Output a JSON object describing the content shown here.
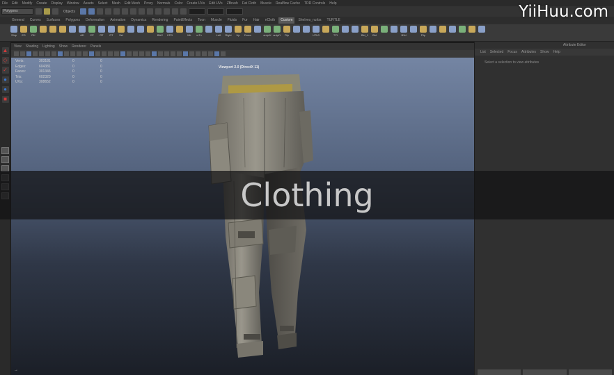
{
  "menubar": {
    "items": [
      "File",
      "Edit",
      "Modify",
      "Create",
      "Display",
      "Window",
      "Assets",
      "Select",
      "Mesh",
      "Edit Mesh",
      "Proxy",
      "Normals",
      "Color",
      "Create UVs",
      "Edit UVs",
      "ZBrush",
      "Fat Cloth",
      "Muscle",
      "Realflow Cache",
      "TDR Controls",
      "Help"
    ]
  },
  "statusline": {
    "mode": "Polygons",
    "snap_label": "Objects"
  },
  "shelf_tabs": {
    "items": [
      "General",
      "Curves",
      "Surfaces",
      "Polygons",
      "Deformation",
      "Animation",
      "Dynamics",
      "Rendering",
      "PaintEffects",
      "Toon",
      "Muscle",
      "Fluids",
      "Fur",
      "Hair",
      "nCloth",
      "Custom",
      "Shelves_nurbs",
      "TURTLE"
    ],
    "active_index": 15
  },
  "shelf": {
    "items": [
      {
        "label": "Ship",
        "color": "c1"
      },
      {
        "label": "ES",
        "color": "c2"
      },
      {
        "label": "RK",
        "color": "c3"
      },
      {
        "label": "",
        "color": "c2"
      },
      {
        "label": "",
        "color": "c2"
      },
      {
        "label": "",
        "color": "c2"
      },
      {
        "label": "",
        "color": "c1"
      },
      {
        "label": "AD",
        "color": "c1"
      },
      {
        "label": "CP",
        "color": "c3"
      },
      {
        "label": "RT",
        "color": "c1"
      },
      {
        "label": "RT",
        "color": "c1"
      },
      {
        "label": "Sel",
        "color": "c2"
      },
      {
        "label": "",
        "color": "c1"
      },
      {
        "label": "",
        "color": "c1"
      },
      {
        "label": "",
        "color": "c2"
      },
      {
        "label": "BAC",
        "color": "c3"
      },
      {
        "label": "CPD",
        "color": "c1"
      },
      {
        "label": "",
        "color": "c2"
      },
      {
        "label": "ML",
        "color": "c1"
      },
      {
        "label": "vrTx",
        "color": "c3"
      },
      {
        "label": "",
        "color": "c1"
      },
      {
        "label": "Left",
        "color": "c1"
      },
      {
        "label": "Right",
        "color": "c1"
      },
      {
        "label": "Up",
        "color": "c2"
      },
      {
        "label": "Down",
        "color": "c2"
      },
      {
        "label": "",
        "color": "c1"
      },
      {
        "label": "aniptX",
        "color": "c3"
      },
      {
        "label": "aniptY",
        "color": "c3"
      },
      {
        "label": "Flip",
        "color": "c2"
      },
      {
        "label": "",
        "color": "c1"
      },
      {
        "label": "",
        "color": "c1"
      },
      {
        "label": "UTkS",
        "color": "c1"
      },
      {
        "label": "",
        "color": "c2"
      },
      {
        "label": "TPI",
        "color": "c3"
      },
      {
        "label": "",
        "color": "c1"
      },
      {
        "label": "",
        "color": "c1"
      },
      {
        "label": "Bld_1",
        "color": "c2"
      },
      {
        "label": "Bld",
        "color": "c2"
      },
      {
        "label": "",
        "color": "c3"
      },
      {
        "label": "",
        "color": "c1"
      },
      {
        "label": "B3d",
        "color": "c1"
      },
      {
        "label": "",
        "color": "c1"
      },
      {
        "label": "Flip",
        "color": "c2"
      },
      {
        "label": "",
        "color": "c1"
      },
      {
        "label": "",
        "color": "c2"
      },
      {
        "label": "",
        "color": "c1"
      },
      {
        "label": "",
        "color": "c3"
      },
      {
        "label": "",
        "color": "c2"
      },
      {
        "label": "",
        "color": "c1"
      }
    ]
  },
  "panel": {
    "menu": [
      "View",
      "Shading",
      "Lighting",
      "Show",
      "Renderer",
      "Panels"
    ]
  },
  "viewport": {
    "title": "Viewport 2.0 (DirectX 11)",
    "hud": [
      [
        "Verts:",
        "303181",
        "0",
        "0"
      ],
      [
        "Edges:",
        "604381",
        "0",
        "0"
      ],
      [
        "Faces:",
        "301346",
        "0",
        "0"
      ],
      [
        "Tris:",
        "602320",
        "0",
        "0"
      ],
      [
        "UVs:",
        "308652",
        "0",
        "0"
      ]
    ]
  },
  "attribute_editor": {
    "title": "Attribute Editor",
    "menu": [
      "List",
      "Selected",
      "Focus",
      "Attributes",
      "Show",
      "Help"
    ],
    "message": "Select a selection to view attributes"
  },
  "overlay": {
    "title": "Clothing",
    "watermark": "YiiHuu.com"
  }
}
